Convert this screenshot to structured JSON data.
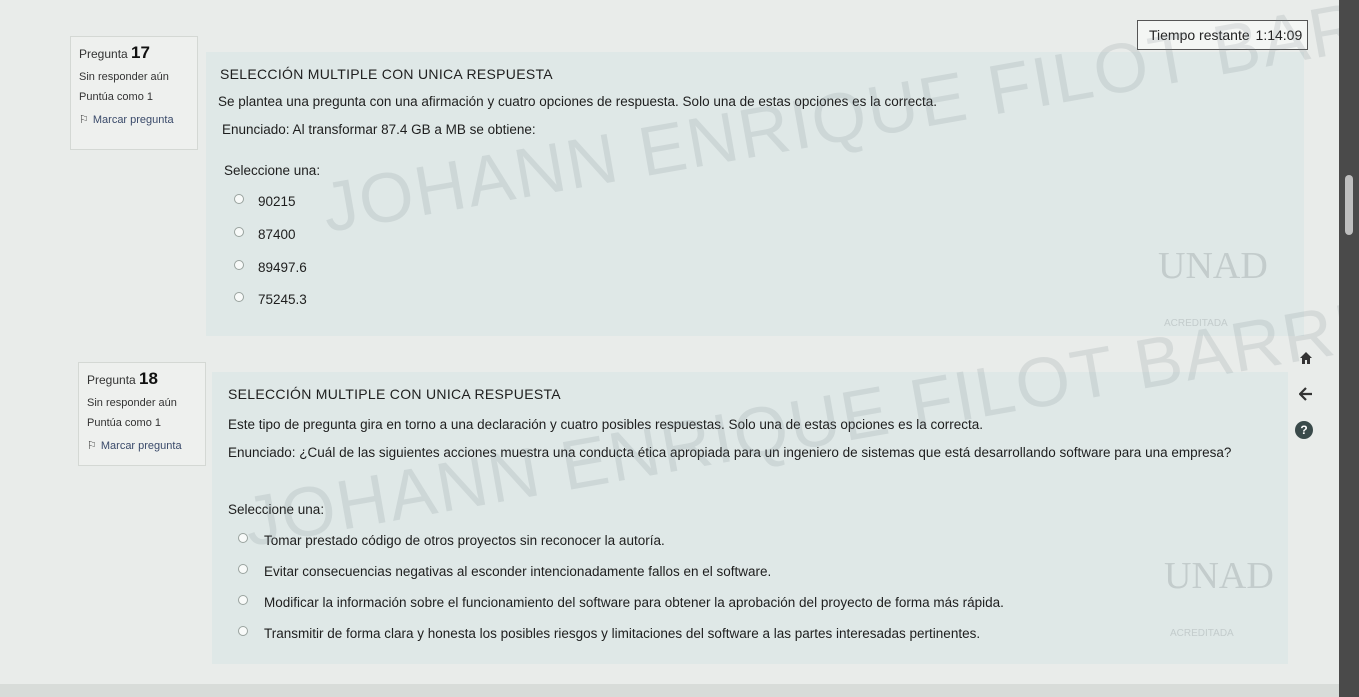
{
  "timer": {
    "label": "Tiempo restante",
    "value": "1:14:09"
  },
  "questions": [
    {
      "prefix": "Pregunta",
      "number": "17",
      "status": "Sin responder aún",
      "points": "Puntúa como 1",
      "flag_label": "Marcar pregunta",
      "type_title": "SELECCIÓN MULTIPLE CON UNICA RESPUESTA",
      "instruction": "Se plantea una pregunta con una afirmación y cuatro opciones de respuesta. Solo una de estas opciones es la correcta.",
      "statement": "Enunciado: Al transformar 87.4 GB a MB se obtiene:",
      "select_label": "Seleccione una:",
      "options": [
        "90215",
        "87400",
        "89497.6",
        "75245.3"
      ]
    },
    {
      "prefix": "Pregunta",
      "number": "18",
      "status": "Sin responder aún",
      "points": "Puntúa como 1",
      "flag_label": "Marcar pregunta",
      "type_title": "SELECCIÓN MULTIPLE CON UNICA RESPUESTA",
      "instruction": "Este tipo de pregunta gira en torno a una declaración y cuatro posibles respuestas. Solo una de estas opciones es la correcta.",
      "statement": "Enunciado: ¿Cuál de las siguientes acciones muestra una conducta ética apropiada para un ingeniero de sistemas que está desarrollando software para una empresa?",
      "select_label": "Seleccione una:",
      "options": [
        "Tomar prestado código de otros proyectos sin reconocer la autoría.",
        "Evitar consecuencias negativas al esconder intencionadamente fallos en el software.",
        "Modificar la información sobre el funcionamiento del software para obtener la aprobación del proyecto de forma más rápida.",
        "Transmitir de forma clara y honesta los posibles riesgos y limitaciones del software a las partes interesadas pertinentes."
      ]
    }
  ],
  "watermark": {
    "text": "JOHANN ENRIQUE FILOT BARRIOS",
    "logo_text": "UNAD",
    "logo_sub": "ACREDITADA"
  },
  "side_nav": {
    "home_icon": "home-icon",
    "back_icon": "back-arrow-icon",
    "help_icon": "help-icon",
    "help_glyph": "?"
  },
  "colors": {
    "content_bg": "#dfe8e7",
    "info_bg": "#eef0ee",
    "page_bg": "#e9ecea",
    "scrollbar": "#4a4a4a"
  }
}
